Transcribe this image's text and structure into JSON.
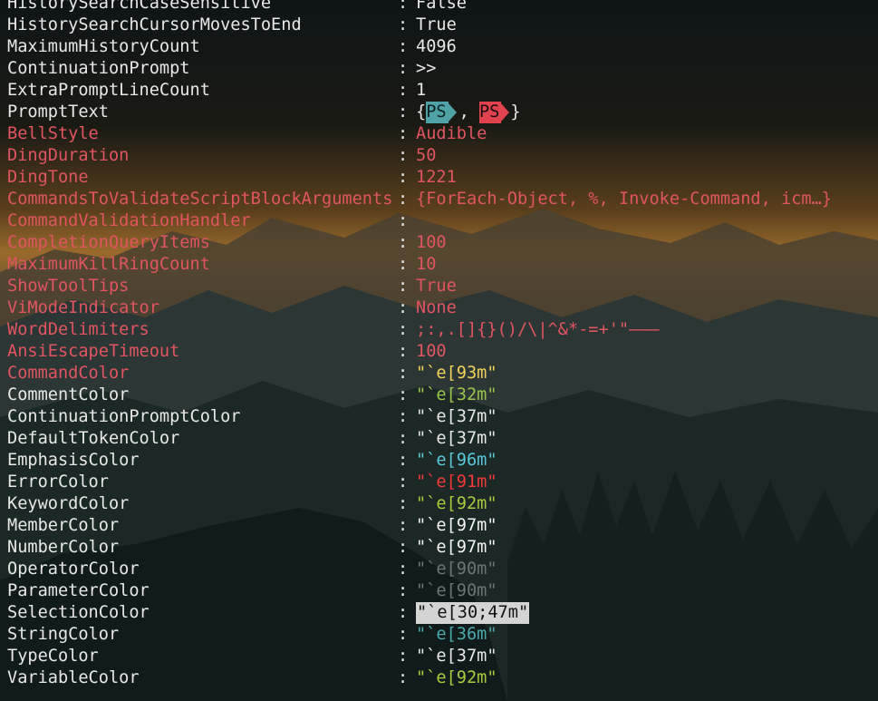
{
  "colors": {
    "default_text": "#e8e8e8",
    "error_property": "#e05561",
    "sky_glow": "#c88a3a"
  },
  "rows": [
    {
      "name": "HistorySearchCaseSensitive",
      "sep": ":",
      "value": "False",
      "style": "white",
      "vcolor": "#e8e8e8"
    },
    {
      "name": "HistorySearchCursorMovesToEnd",
      "sep": ":",
      "value": "True",
      "style": "white",
      "vcolor": "#e8e8e8"
    },
    {
      "name": "MaximumHistoryCount",
      "sep": ":",
      "value": "4096",
      "style": "white",
      "vcolor": "#e8e8e8"
    },
    {
      "name": "ContinuationPrompt",
      "sep": ":",
      "value": ">>",
      "style": "white",
      "vcolor": "#e8e8e8"
    },
    {
      "name": "ExtraPromptLineCount",
      "sep": ":",
      "value": "1",
      "style": "white",
      "vcolor": "#e8e8e8"
    },
    {
      "name": "PromptText",
      "sep": ":",
      "value": "",
      "style": "white",
      "vcolor": "#e8e8e8",
      "prompt": true
    },
    {
      "name": "BellStyle",
      "sep": ":",
      "value": "Audible",
      "style": "red",
      "vcolor": "#e05561"
    },
    {
      "name": "DingDuration",
      "sep": ":",
      "value": "50",
      "style": "red",
      "vcolor": "#e05561"
    },
    {
      "name": "DingTone",
      "sep": ":",
      "value": "1221",
      "style": "red",
      "vcolor": "#e05561"
    },
    {
      "name": "CommandsToValidateScriptBlockArguments",
      "sep": ":",
      "value": "{ForEach-Object, %, Invoke-Command, icm…}",
      "style": "red",
      "vcolor": "#e05561"
    },
    {
      "name": "CommandValidationHandler",
      "sep": ":",
      "value": "",
      "style": "red",
      "vcolor": "#e05561"
    },
    {
      "name": "CompletionQueryItems",
      "sep": ":",
      "value": "100",
      "style": "red",
      "vcolor": "#e05561"
    },
    {
      "name": "MaximumKillRingCount",
      "sep": ":",
      "value": "10",
      "style": "red",
      "vcolor": "#e05561"
    },
    {
      "name": "ShowToolTips",
      "sep": ":",
      "value": "True",
      "style": "red",
      "vcolor": "#e05561"
    },
    {
      "name": "ViModeIndicator",
      "sep": ":",
      "value": "None",
      "style": "red",
      "vcolor": "#e05561"
    },
    {
      "name": "WordDelimiters",
      "sep": ":",
      "value": ";:,.[]{}()/\\|^&*-=+'\"–—―",
      "style": "red",
      "vcolor": "#e05561"
    },
    {
      "name": "AnsiEscapeTimeout",
      "sep": ":",
      "value": "100",
      "style": "red",
      "vcolor": "#e05561"
    },
    {
      "name": "CommandColor",
      "sep": ":",
      "value": "\"`e[93m\"",
      "style": "red",
      "vcolor": "#f0d35a"
    },
    {
      "name": "CommentColor",
      "sep": ":",
      "value": "\"`e[32m\"",
      "style": "white",
      "vcolor": "#9ac34a"
    },
    {
      "name": "ContinuationPromptColor",
      "sep": ":",
      "value": "\"`e[37m\"",
      "style": "white",
      "vcolor": "#e8e8e8"
    },
    {
      "name": "DefaultTokenColor",
      "sep": ":",
      "value": "\"`e[37m\"",
      "style": "white",
      "vcolor": "#e8e8e8"
    },
    {
      "name": "EmphasisColor",
      "sep": ":",
      "value": "\"`e[96m\"",
      "style": "white",
      "vcolor": "#56c8d8"
    },
    {
      "name": "ErrorColor",
      "sep": ":",
      "value": "\"`e[91m\"",
      "style": "white",
      "vcolor": "#f03a3a"
    },
    {
      "name": "KeywordColor",
      "sep": ":",
      "value": "\"`e[92m\"",
      "style": "white",
      "vcolor": "#a6cc3c"
    },
    {
      "name": "MemberColor",
      "sep": ":",
      "value": "\"`e[97m\"",
      "style": "white",
      "vcolor": "#f4f4f4"
    },
    {
      "name": "NumberColor",
      "sep": ":",
      "value": "\"`e[97m\"",
      "style": "white",
      "vcolor": "#f4f4f4"
    },
    {
      "name": "OperatorColor",
      "sep": ":",
      "value": "\"`e[90m\"",
      "style": "white",
      "vcolor": "#6e7476"
    },
    {
      "name": "ParameterColor",
      "sep": ":",
      "value": "\"`e[90m\"",
      "style": "white",
      "vcolor": "#6e7476"
    },
    {
      "name": "SelectionColor",
      "sep": ":",
      "value": "\"`e[30;47m\"",
      "style": "white",
      "vcolor": "#111111",
      "selection": true
    },
    {
      "name": "StringColor",
      "sep": ":",
      "value": "\"`e[36m\"",
      "style": "white",
      "vcolor": "#4aa8a8"
    },
    {
      "name": "TypeColor",
      "sep": ":",
      "value": "\"`e[37m\"",
      "style": "white",
      "vcolor": "#e8e8e8"
    },
    {
      "name": "VariableColor",
      "sep": ":",
      "value": "\"`e[92m\"",
      "style": "white",
      "vcolor": "#a6cc3c"
    }
  ],
  "prompt_text": {
    "open": "{",
    "first": "PS",
    "comma": ", ",
    "second": "PS",
    "close": "}"
  }
}
